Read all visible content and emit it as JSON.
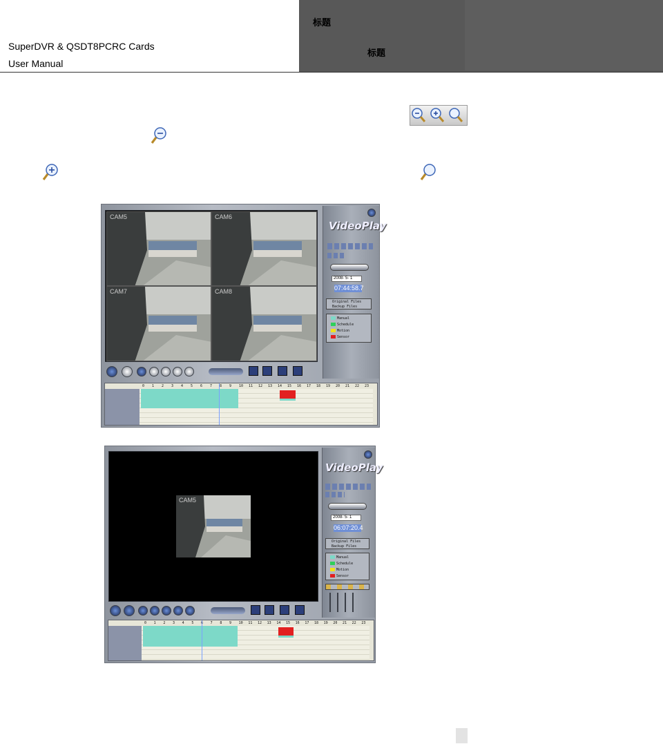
{
  "header": {
    "doc_title": "SuperDVR & QSDT8PCRC Cards",
    "doc_subtitle": "User Manual",
    "label_top": "标题",
    "label_bottom": "标题"
  },
  "icons": {
    "zoom_toolbar": [
      "zoom-out-icon",
      "zoom-in-icon",
      "zoom-fit-icon"
    ],
    "inline_zoom_out": "zoom-out-icon",
    "inline_zoom_in": "zoom-in-icon",
    "inline_zoom_reset": "zoom-reset-icon"
  },
  "screenshot1": {
    "cameras": [
      "CAM5",
      "CAM6",
      "CAM7",
      "CAM8"
    ],
    "panel_title": "VideoPlay",
    "date": "2008- 5- 1",
    "time": "07:44:58.7",
    "file_options": [
      "Original Files",
      "Backup Files"
    ],
    "legend": [
      "Manual",
      "Schedule",
      "Motion",
      "Sensor"
    ],
    "hours": [
      "0",
      "1",
      "2",
      "3",
      "4",
      "5",
      "6",
      "7",
      "8",
      "9",
      "10",
      "11",
      "12",
      "13",
      "14",
      "15",
      "16",
      "17",
      "18",
      "19",
      "20",
      "21",
      "22",
      "23"
    ]
  },
  "screenshot2": {
    "cameras": [
      "CAM5"
    ],
    "panel_title": "VideoPlay",
    "date": "2008- 5- 1",
    "time": "06:07:20.4",
    "file_options": [
      "Original Files",
      "Backup Files"
    ],
    "legend": [
      "Manual",
      "Schedule",
      "Motion",
      "Sensor"
    ],
    "hours": [
      "0",
      "1",
      "2",
      "3",
      "4",
      "5",
      "6",
      "7",
      "8",
      "9",
      "10",
      "11",
      "12",
      "13",
      "14",
      "15",
      "16",
      "17",
      "18",
      "19",
      "20",
      "21",
      "22",
      "23"
    ]
  },
  "colors": {
    "manual": "#7dd9c8",
    "schedule": "#2fd05a",
    "motion": "#f1e21a",
    "sensor": "#e22020"
  }
}
